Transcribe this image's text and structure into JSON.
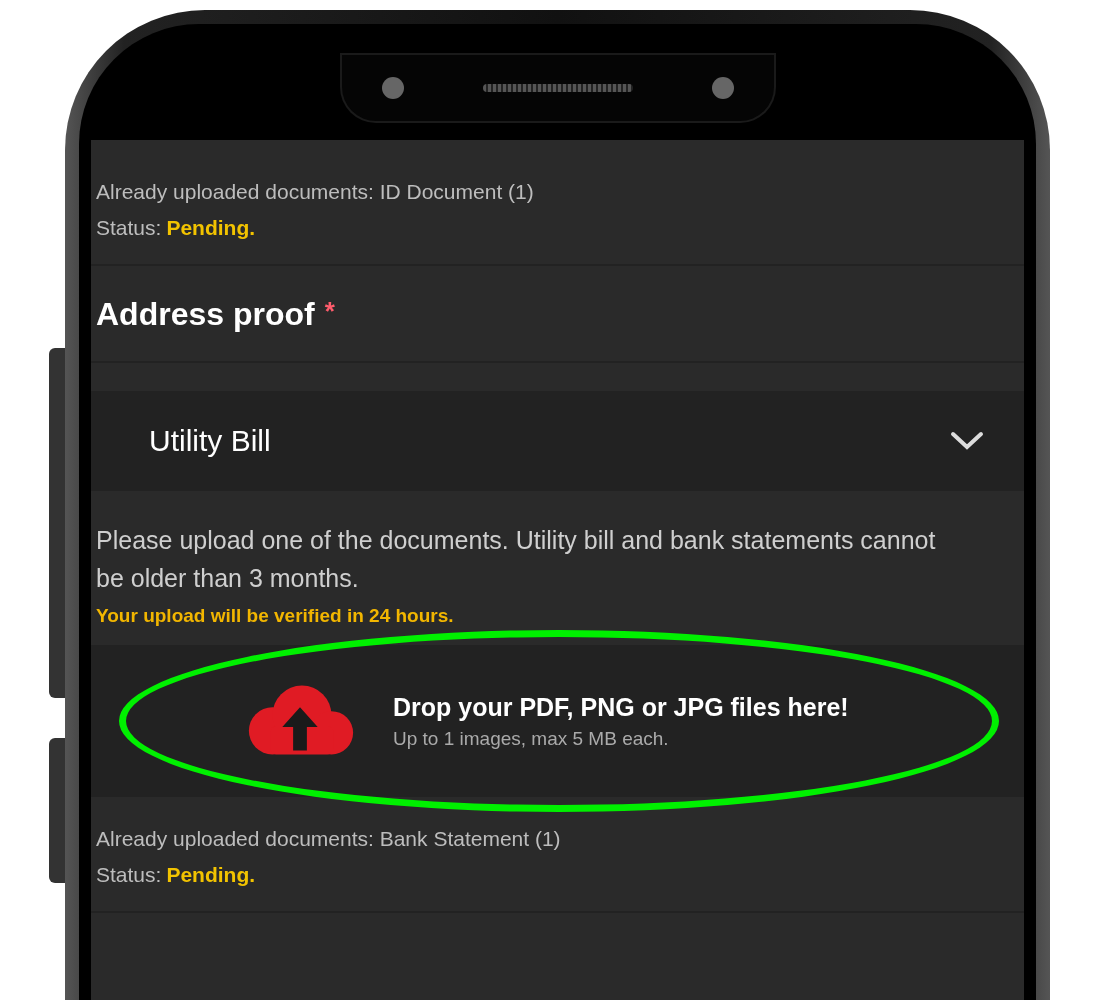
{
  "uploaded_top": {
    "text": "Already uploaded documents: ID Document (1)",
    "status_label": "Status:",
    "status": "Pending."
  },
  "section": {
    "title": "Address proof",
    "required_mark": "*"
  },
  "document_select": {
    "value": "Utility Bill"
  },
  "instructions": "Please upload one of the documents. Utility bill and bank statements cannot be older than 3 months.",
  "verification_note": "Your upload will be verified in 24 hours.",
  "upload_zone": {
    "title": "Drop your PDF, PNG or JPG files here!",
    "subtitle": "Up to 1 images, max 5 MB each.",
    "highlighted": true
  },
  "uploaded_bottom": {
    "text": "Already uploaded documents: Bank Statement (1)",
    "status_label": "Status:",
    "status": "Pending."
  }
}
